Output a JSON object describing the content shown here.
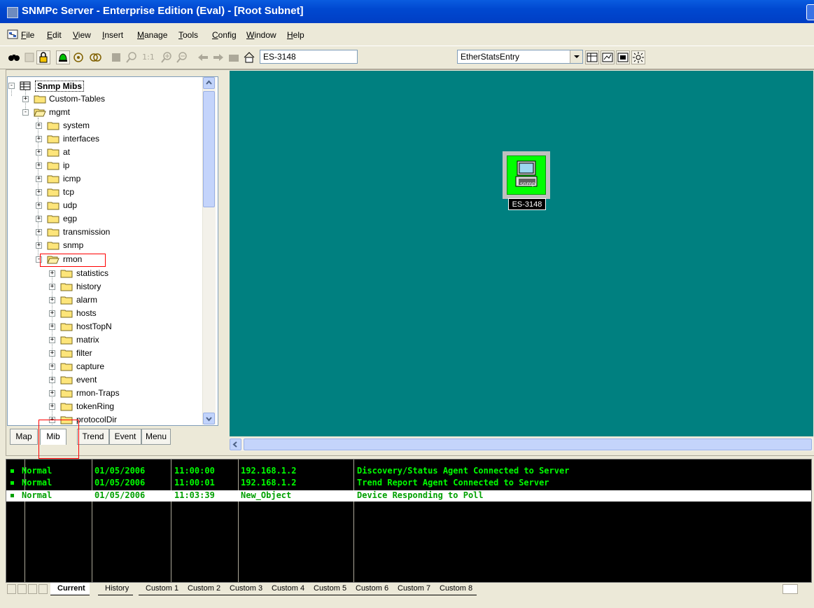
{
  "window": {
    "title": "SNMPc Server - Enterprise Edition (Eval) - [Root Subnet]"
  },
  "menu": [
    "File",
    "Edit",
    "View",
    "Insert",
    "Manage",
    "Tools",
    "Config",
    "Window",
    "Help"
  ],
  "toolbar": {
    "device_combo": "ES-3148",
    "mib_combo": "EtherStatsEntry",
    "zoom_label": "1:1"
  },
  "tree": {
    "root": "Snmp Mibs",
    "custom_tables": "Custom-Tables",
    "mgmt": "mgmt",
    "mgmt_children": [
      "system",
      "interfaces",
      "at",
      "ip",
      "icmp",
      "tcp",
      "udp",
      "egp",
      "transmission",
      "snmp"
    ],
    "rmon": "rmon",
    "rmon_children": [
      "statistics",
      "history",
      "alarm",
      "hosts",
      "hostTopN",
      "matrix",
      "filter",
      "capture",
      "event",
      "rmon-Traps",
      "tokenRing",
      "protocolDir"
    ]
  },
  "left_tabs": [
    "Map",
    "Mib",
    "Trend",
    "Event",
    "Menu"
  ],
  "map": {
    "device_label": "ES-3148",
    "device_icon_text": "snmp"
  },
  "events": [
    {
      "status": "Normal",
      "date": "01/05/2006",
      "time": "11:00:00",
      "source": "192.168.1.2",
      "message": "Discovery/Status Agent Connected to Server"
    },
    {
      "status": "Normal",
      "date": "01/05/2006",
      "time": "11:00:01",
      "source": "192.168.1.2",
      "message": "Trend Report Agent Connected to Server"
    },
    {
      "status": "Normal",
      "date": "01/05/2006",
      "time": "11:03:39",
      "source": "New_Object",
      "message": "Device Responding to Poll"
    }
  ],
  "event_tabs": [
    "Current",
    "History",
    "Custom 1",
    "Custom 2",
    "Custom 3",
    "Custom 4",
    "Custom 5",
    "Custom 6",
    "Custom 7",
    "Custom 8"
  ],
  "colors": {
    "map_bg": "#008080",
    "event_text": "#00ff00",
    "highlight_box": "#ff0000",
    "title_bar": "#0048d0"
  }
}
